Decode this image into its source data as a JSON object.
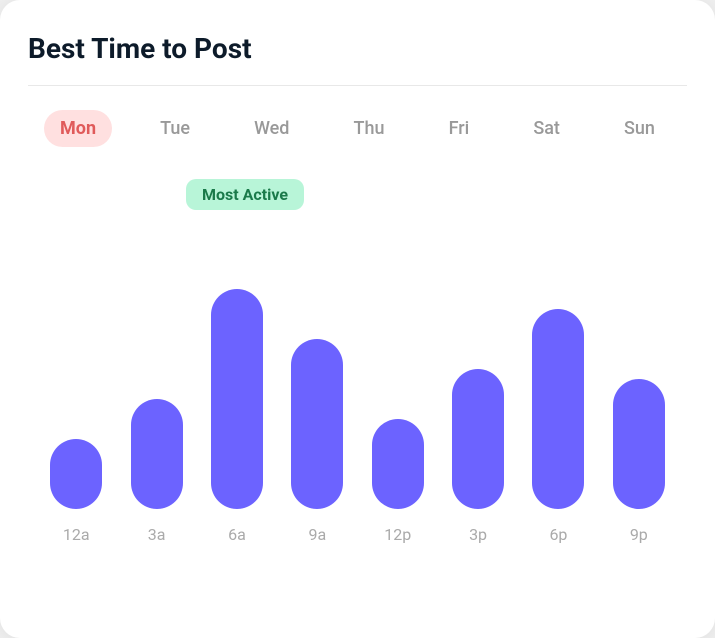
{
  "title": "Best Time to Post",
  "days": [
    {
      "label": "Mon",
      "active": true
    },
    {
      "label": "Tue",
      "active": false
    },
    {
      "label": "Wed",
      "active": false
    },
    {
      "label": "Thu",
      "active": false
    },
    {
      "label": "Fri",
      "active": false
    },
    {
      "label": "Sat",
      "active": false
    },
    {
      "label": "Sun",
      "active": false
    }
  ],
  "most_active_label": "Most Active",
  "time_labels": [
    "12a",
    "3a",
    "6a",
    "9a",
    "12p",
    "3p",
    "6p",
    "9p"
  ],
  "bar_heights": [
    70,
    110,
    220,
    170,
    90,
    140,
    200,
    130
  ],
  "bar_color": "#6c63ff",
  "active_bar_index": 2
}
